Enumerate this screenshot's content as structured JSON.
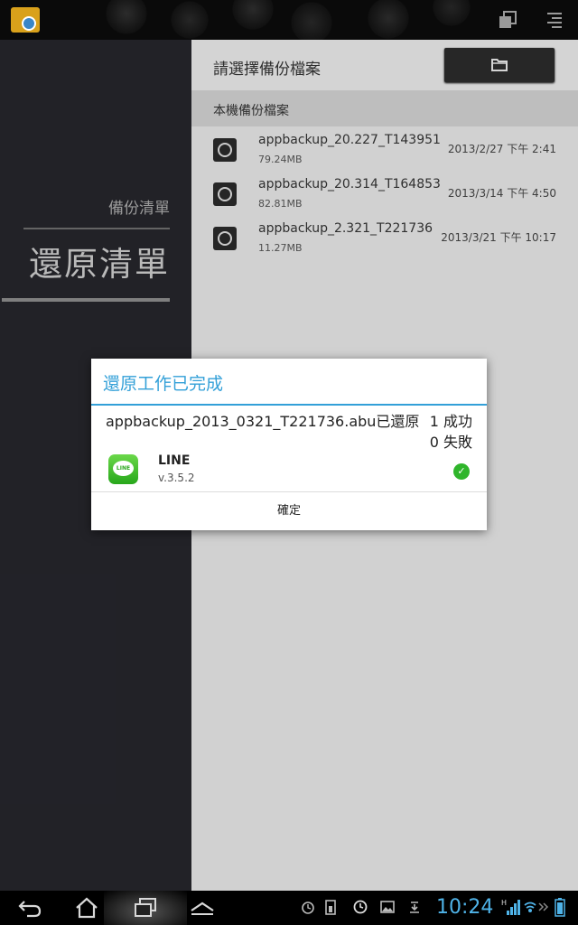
{
  "colors": {
    "accent": "#33a0d8",
    "sidebar": "#25252b",
    "success": "#2fb52b"
  },
  "sidebar": {
    "backup_label": "備份清單",
    "restore_label": "還原清單"
  },
  "main": {
    "title": "請選擇備份檔案",
    "folder_icon": "folder-icon",
    "section_label": "本機備份檔案",
    "files": [
      {
        "name": "appbackup_20.227_T143951",
        "size": "79.24MB",
        "date": "2013/2/27 下午 2:41"
      },
      {
        "name": "appbackup_20.314_T164853",
        "size": "82.81MB",
        "date": "2013/3/14 下午 4:50"
      },
      {
        "name": "appbackup_2.321_T221736",
        "size": "11.27MB",
        "date": "2013/3/21 下午 10:17"
      }
    ]
  },
  "dialog": {
    "title": "還原工作已完成",
    "file_message": "appbackup_2013_0321_T221736.abu已還原",
    "success_text": "1 成功",
    "fail_text": "0 失敗",
    "app_name": "LINE",
    "app_version": "v.3.5.2",
    "app_icon_text": "LINE",
    "status_icon": "check-circle-icon",
    "confirm_label": "確定"
  },
  "status_bar": {
    "time": "10:24"
  }
}
